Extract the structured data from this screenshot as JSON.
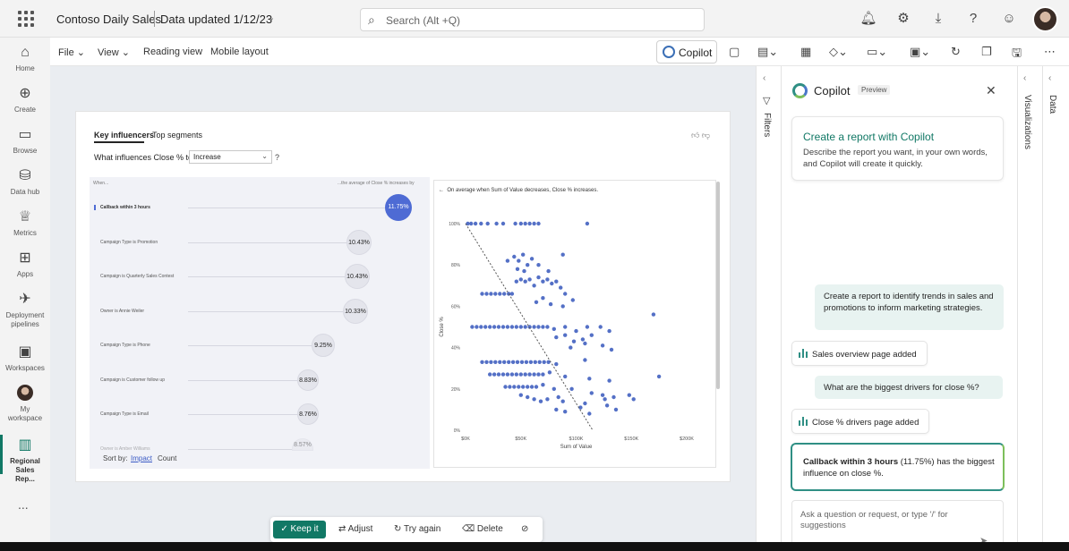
{
  "topbar": {
    "app_title": "Contoso Daily Sales",
    "data_updated": "Data updated 1/12/23",
    "search_placeholder": "Search (Alt +Q)"
  },
  "leftnav": {
    "items": [
      {
        "label": "Home",
        "icon": "home-icon"
      },
      {
        "label": "Create",
        "icon": "plus-circle-icon"
      },
      {
        "label": "Browse",
        "icon": "folder-icon"
      },
      {
        "label": "Data hub",
        "icon": "database-icon"
      },
      {
        "label": "Metrics",
        "icon": "trophy-icon"
      },
      {
        "label": "Apps",
        "icon": "apps-icon"
      },
      {
        "label": "Deployment pipelines",
        "icon": "rocket-icon"
      },
      {
        "label": "Workspaces",
        "icon": "workspaces-icon"
      },
      {
        "label": "My workspace",
        "icon": "avatar-icon"
      },
      {
        "label": "Regional Sales Rep...",
        "icon": "report-icon"
      }
    ],
    "more": "..."
  },
  "toolbar": {
    "file": "File",
    "view": "View",
    "reading_view": "Reading view",
    "mobile_layout": "Mobile layout",
    "copilot": "Copilot"
  },
  "report": {
    "tab_key_influencers": "Key influencers",
    "tab_top_segments": "Top segments",
    "question": "What influences Close % to",
    "dropdown_value": "Increase",
    "question_mark": "?",
    "when_header": "When...",
    "avg_header": "...the average of Close % increases by",
    "influencers": [
      {
        "label": "Callback within 3 hours",
        "value": "11.75%"
      },
      {
        "label": "Campaign Type is Promotion",
        "value": "10.43%"
      },
      {
        "label": "Campaign is Quarterly Sales Contest",
        "value": "10.43%"
      },
      {
        "label": "Owner is Annie Weiler",
        "value": "10.33%"
      },
      {
        "label": "Campaign Type is Phone",
        "value": "9.25%"
      },
      {
        "label": "Campaign is Customer follow up",
        "value": "8.83%"
      },
      {
        "label": "Campaign Type is Email",
        "value": "8.76%"
      },
      {
        "label": "Owner is Amber Williams",
        "value": "8.57%"
      }
    ],
    "sort_by": "Sort by:",
    "sort_impact": "Impact",
    "sort_count": "Count",
    "scatter_header": "On average when Sum of Value decreases, Close % increases."
  },
  "chart_data": {
    "type": "scatter",
    "xlabel": "Sum of Value",
    "ylabel": "Close %",
    "xlim": [
      0,
      200000
    ],
    "ylim": [
      0,
      100
    ],
    "x_ticks": [
      "$0K",
      "$50K",
      "$100K",
      "$150K",
      "$200K"
    ],
    "y_ticks": [
      "0%",
      "20%",
      "40%",
      "60%",
      "80%",
      "100%"
    ],
    "trendline": [
      [
        0,
        100
      ],
      [
        115000,
        0
      ]
    ],
    "points": [
      [
        2000,
        100
      ],
      [
        5000,
        100
      ],
      [
        9000,
        100
      ],
      [
        14000,
        100
      ],
      [
        20000,
        100
      ],
      [
        28000,
        100
      ],
      [
        34000,
        100
      ],
      [
        45000,
        100
      ],
      [
        50000,
        100
      ],
      [
        54000,
        100
      ],
      [
        58000,
        100
      ],
      [
        62000,
        100
      ],
      [
        66000,
        100
      ],
      [
        110000,
        100
      ],
      [
        38000,
        82
      ],
      [
        44000,
        84
      ],
      [
        48000,
        82
      ],
      [
        52000,
        85
      ],
      [
        56000,
        80
      ],
      [
        60000,
        83
      ],
      [
        47000,
        78
      ],
      [
        53000,
        77
      ],
      [
        66000,
        80
      ],
      [
        75000,
        77
      ],
      [
        88000,
        85
      ],
      [
        15000,
        66
      ],
      [
        19000,
        66
      ],
      [
        23000,
        66
      ],
      [
        27000,
        66
      ],
      [
        31000,
        66
      ],
      [
        35000,
        66
      ],
      [
        39000,
        66
      ],
      [
        42000,
        66
      ],
      [
        46000,
        72
      ],
      [
        50000,
        73
      ],
      [
        54000,
        72
      ],
      [
        58000,
        73
      ],
      [
        62000,
        70
      ],
      [
        66000,
        74
      ],
      [
        70000,
        72
      ],
      [
        74000,
        73
      ],
      [
        78000,
        71
      ],
      [
        82000,
        72
      ],
      [
        86000,
        69
      ],
      [
        90000,
        66
      ],
      [
        64000,
        62
      ],
      [
        70000,
        64
      ],
      [
        77000,
        61
      ],
      [
        88000,
        60
      ],
      [
        97000,
        63
      ],
      [
        6000,
        50
      ],
      [
        10000,
        50
      ],
      [
        14000,
        50
      ],
      [
        18000,
        50
      ],
      [
        22000,
        50
      ],
      [
        26000,
        50
      ],
      [
        30000,
        50
      ],
      [
        34000,
        50
      ],
      [
        38000,
        50
      ],
      [
        42000,
        50
      ],
      [
        46000,
        50
      ],
      [
        50000,
        50
      ],
      [
        54000,
        50
      ],
      [
        58000,
        50
      ],
      [
        62000,
        50
      ],
      [
        66000,
        50
      ],
      [
        70000,
        50
      ],
      [
        74000,
        50
      ],
      [
        80000,
        49
      ],
      [
        90000,
        50
      ],
      [
        100000,
        48
      ],
      [
        110000,
        50
      ],
      [
        122000,
        50
      ],
      [
        130000,
        48
      ],
      [
        170000,
        56
      ],
      [
        82000,
        45
      ],
      [
        90000,
        46
      ],
      [
        98000,
        43
      ],
      [
        106000,
        44
      ],
      [
        114000,
        46
      ],
      [
        95000,
        40
      ],
      [
        108000,
        42
      ],
      [
        124000,
        41
      ],
      [
        132000,
        39
      ],
      [
        15000,
        33
      ],
      [
        19000,
        33
      ],
      [
        23000,
        33
      ],
      [
        27000,
        33
      ],
      [
        31000,
        33
      ],
      [
        35000,
        33
      ],
      [
        39000,
        33
      ],
      [
        43000,
        33
      ],
      [
        47000,
        33
      ],
      [
        51000,
        33
      ],
      [
        55000,
        33
      ],
      [
        59000,
        33
      ],
      [
        63000,
        33
      ],
      [
        67000,
        33
      ],
      [
        71000,
        33
      ],
      [
        75000,
        33
      ],
      [
        82000,
        32
      ],
      [
        108000,
        34
      ],
      [
        22000,
        27
      ],
      [
        26000,
        27
      ],
      [
        30000,
        27
      ],
      [
        34000,
        27
      ],
      [
        38000,
        27
      ],
      [
        42000,
        27
      ],
      [
        46000,
        27
      ],
      [
        50000,
        27
      ],
      [
        54000,
        27
      ],
      [
        58000,
        27
      ],
      [
        62000,
        27
      ],
      [
        66000,
        27
      ],
      [
        70000,
        27
      ],
      [
        76000,
        28
      ],
      [
        90000,
        26
      ],
      [
        112000,
        25
      ],
      [
        130000,
        24
      ],
      [
        175000,
        26
      ],
      [
        36000,
        21
      ],
      [
        40000,
        21
      ],
      [
        44000,
        21
      ],
      [
        48000,
        21
      ],
      [
        52000,
        21
      ],
      [
        56000,
        21
      ],
      [
        60000,
        21
      ],
      [
        64000,
        21
      ],
      [
        70000,
        22
      ],
      [
        80000,
        20
      ],
      [
        96000,
        20
      ],
      [
        114000,
        18
      ],
      [
        124000,
        17
      ],
      [
        134000,
        16
      ],
      [
        148000,
        17
      ],
      [
        152000,
        15
      ],
      [
        50000,
        17
      ],
      [
        56000,
        16
      ],
      [
        62000,
        15
      ],
      [
        68000,
        14
      ],
      [
        74000,
        15
      ],
      [
        84000,
        16
      ],
      [
        88000,
        14
      ],
      [
        108000,
        13
      ],
      [
        126000,
        15
      ],
      [
        82000,
        10
      ],
      [
        90000,
        9
      ],
      [
        104000,
        11
      ],
      [
        112000,
        8
      ],
      [
        128000,
        12
      ],
      [
        136000,
        10
      ]
    ]
  },
  "floatbar": {
    "keep_it": "Keep it",
    "adjust": "Adjust",
    "try_again": "Try again",
    "delete": "Delete"
  },
  "filters_label": "Filters",
  "copilot": {
    "title": "Copilot",
    "preview": "Preview",
    "create_title": "Create a report with Copilot",
    "create_desc": "Describe the report you want, in your own words, and Copilot will create it quickly.",
    "user_msg_1": "Create a report to identify trends in sales and promotions to inform marketing strategies.",
    "bot_msg_1": "Sales overview page added",
    "user_msg_2": "What are the biggest drivers for close %?",
    "bot_msg_2": "Close % drivers page added",
    "answer_bold": "Callback within 3 hours",
    "answer_rest": " (11.75%) has the biggest influence on close %.",
    "ask_placeholder": "Ask a question or request, or type '/' for suggestions"
  },
  "visualizations_label": "Visualizations",
  "data_label": "Data",
  "colors": {
    "accent": "#117865",
    "scatter_point": "#5470c6",
    "selected_bubble": "#4e6bd4"
  }
}
